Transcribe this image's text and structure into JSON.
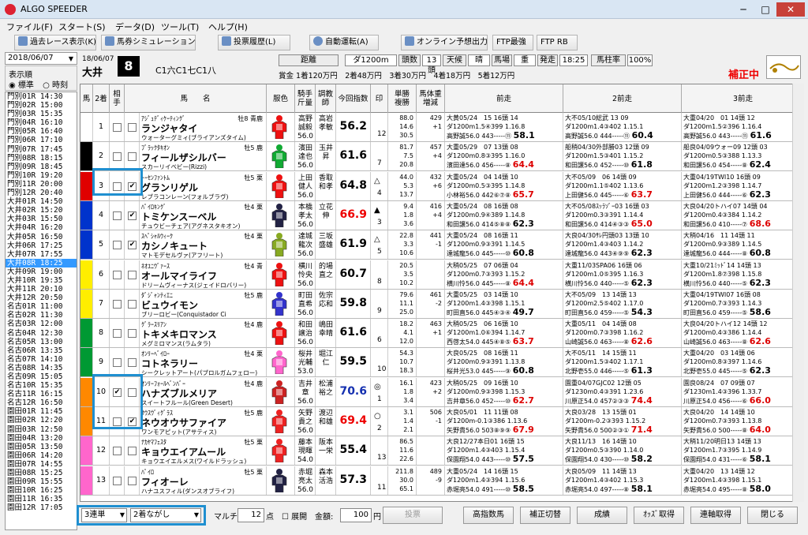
{
  "window": {
    "title": "ALGO SPEEDER",
    "minimize": "─",
    "maximize": "□",
    "close": "✕"
  },
  "menu": [
    "ファイル(F)",
    "スタート(S)",
    "データ(D)",
    "ツール(T)",
    "ヘルプ(H)"
  ],
  "toolbar": [
    "過去レース表示(K)",
    "馬券シミュレーション(B)",
    "投票履歴(L)",
    "自動運転(A)",
    "オンライン予想出力",
    "FTP最強",
    "FTP RB"
  ],
  "left": {
    "date": "2018/06/07",
    "order_label": "表示順",
    "order_opts": [
      "標準",
      "時刻"
    ],
    "races": [
      "門別01R 14:30",
      "門別02R 15:00",
      "門別03R 15:35",
      "門別04R 16:10",
      "門別05R 16:40",
      "門別06R 17:10",
      "門別07R 17:45",
      "門別08R 18:15",
      "門別09R 18:45",
      "門別10R 19:20",
      "門別11R 20:00",
      "門別12R 20:40",
      "大井01R 14:50",
      "大井02R 15:20",
      "大井03R 15:50",
      "大井04R 16:20",
      "大井05R 16:50",
      "大井06R 17:25",
      "大井07R 17:55",
      "大井08R 18:25",
      "大井09R 19:00",
      "大井10R 19:35",
      "大井11R 20:10",
      "大井12R 20:50",
      "名古01R 11:00",
      "名古02R 11:30",
      "名古03R 12:00",
      "名古04R 12:30",
      "名古05R 13:00",
      "名古06R 13:35",
      "名古07R 14:10",
      "名古08R 14:35",
      "名古09R 15:05",
      "名古10R 15:35",
      "名古11R 16:15",
      "名古12R 16:50",
      "園田01R 11:45",
      "園田02R 12:20",
      "園田03R 12:50",
      "園田04R 13:20",
      "園田05R 13:50",
      "園田06R 14:20",
      "園田07R 14:55",
      "園田08R 15:25",
      "園田09R 15:55",
      "園田10R 16:25",
      "園田11R 16:35",
      "園田12R 17:05"
    ],
    "selected": 19
  },
  "header": {
    "date": "18/06/07",
    "venue": "大井",
    "racenum": "8",
    "class": "C1六C1七C1八",
    "cond": [
      [
        "距離",
        "ダ1200m"
      ],
      [
        "頭数",
        "13頭"
      ],
      [
        "天候",
        "晴"
      ],
      [
        "馬場",
        "重"
      ],
      [
        "発走",
        "18:25"
      ],
      [
        "馬柱率",
        "100%"
      ]
    ],
    "prize": "賞金 1着120万円　2着48万円　3着30万円　4着18万円　5着12万円",
    "hoseichu": "補正中"
  },
  "cols": [
    "馬",
    "2着",
    "相手",
    "馬　　名",
    "服色",
    "騎手\n斤量",
    "調教\n師",
    "今回指数",
    "印",
    "単勝\n複勝",
    "馬体重\n増減",
    "前走",
    "2前走",
    "3前走"
  ],
  "horses": [
    {
      "w": 1,
      "n": "1",
      "c2": false,
      "ai": false,
      "sire": "ｱｼﾞｭﾃﾞｨｹｰﾃｨﾝｸﾞ",
      "sex": "牡8 青鹿",
      "name": "ランジャタイ",
      "dam": "ウォーターグミィ(ブライアンズタイム)",
      "jk": "高野\n誠毅\n56.0",
      "tr": "高岩\n孝敏",
      "ix": "56.2",
      "ixc": "",
      "mk": "",
      "pop": "12",
      "od": "88.0\n14.6\n30.5",
      "wt": "429\n+1",
      "p1": [
        "大黄05/24　15 16頭 14",
        "ダ1200m1.5④399 1.16.8",
        "高野誠56.0 443-----⑪ 58.1"
      ],
      "p2": [
        "大不05/10総武 13 09",
        "ダ1200m1.4③402 1.15.1",
        "高野誠56.0 444-----⑪ 60.4"
      ],
      "p3": [
        "大重04/20　01 14頭 12",
        "ダ1200m1.5②396 1.16.4",
        "高野誠56.0 443-----⑪ 61.6"
      ]
    },
    {
      "w": 2,
      "n": "2",
      "c2": false,
      "ai": false,
      "sire": "ﾌﾞﾗｯｸﾀｷｵﾝ",
      "sex": "牡5 鹿",
      "name": "フィールザシルバー",
      "dam": "スカーリイベビー(Rizzi)",
      "jk": "濱田\n達也\n56.0",
      "tr": "玉井\n昇",
      "ix": "61.6",
      "ixc": "",
      "mk": "",
      "pop": "7",
      "od": "81.7\n7.5\n20.8",
      "wt": "457\n+4",
      "p1": [
        "大重05/29　07 13頭 08",
        "ダ1200m0.8③395 1.16.0",
        "濱田達56.0 456-----⑧ 64.4"
      ],
      "p2": [
        "船稍04/30外部勝03 12頭 09",
        "ダ1200m1.5③401 1.15.2",
        "和田譲56.0 452-----⑩ 61.8"
      ],
      "p3": [
        "船良04/09ウォー09 12頭 03",
        "ダ1200m0.5③388 1.13.3",
        "和田譲56.0 454-----⑧ 62.4"
      ]
    },
    {
      "w": 3,
      "n": "3",
      "c2": false,
      "ai": true,
      "sire": "ﾄｰｾﾝﾌｧﾝﾄﾑ",
      "sex": "牡5 栗",
      "name": "グランリゲル",
      "dam": "レブラコンレーン(フォルブラヴ)",
      "jk": "上田\n健人\n56.0",
      "tr": "香取\n和孝",
      "ix": "64.8",
      "ixc": "",
      "mk": "△",
      "pop": "4",
      "od": "44.0\n5.3\n13.7",
      "wt": "432\n+6",
      "p1": [
        "大重05/24　04 14頭 10",
        "ダ1200m0.5③395 1.14.8",
        "小林裕56.0 442⑥⑦⑧ 65.7"
      ],
      "p2": [
        "大不05/09　06 14頭 09",
        "ダ1200m1.1⑤402 1.13.6",
        "上田健56.0 445-----⑥ 63.7"
      ],
      "p3": [
        "大重04/19TWI10 16頭 09",
        "ダ1200m1.2③398 1.14.7",
        "上田健56.0 444-----⑥ 62.3"
      ]
    },
    {
      "w": 4,
      "n": "4",
      "c2": false,
      "ai": true,
      "sire": "ﾊﾟｲﾛｷﾝｸﾞ",
      "sex": "牡4 栗",
      "name": "トミケンスーベル",
      "dam": "チュウビーチェア(アグネスタキオン)",
      "jk": "本橋\n孝太\n56.0",
      "tr": "立花\n伸",
      "ix": "66.9",
      "ixc": "red",
      "mk": "▲",
      "pop": "3",
      "od": "9.4\n1.8\n3.6",
      "wt": "416\n+4",
      "p1": [
        "大重05/24　08 16頭 08",
        "ダ1200m0.9④389 1.14.8",
        "和田譲56.0 414⑤⑧⑧ 62.3"
      ],
      "p2": [
        "大不05/08ｽｯﾗｿﾞｰ03 16頭 03",
        "ダ1200m0.3③391 1.14.4",
        "和田譲56.0 414④③③ 65.0"
      ],
      "p3": [
        "大良04/20トハイ07 14頭 04",
        "ダ1200m0.4③384 1.14.2",
        "和田譲56.0 410-----⑦ 68.6"
      ]
    },
    {
      "w": 4,
      "n": "5",
      "c2": false,
      "ai": true,
      "sire": "ｽﾍﾟｼｬﾙｳｨｰｸ",
      "sex": "牡4 栗",
      "name": "カシノキュート",
      "dam": "マトモデセルヴァ(アフリート)",
      "jk": "達城\n龍次\n56.0",
      "tr": "三坂\n盛雄",
      "ix": "61.9",
      "ixc": "",
      "mk": "△",
      "pop": "5",
      "od": "22.8\n3.3\n10.6",
      "wt": "441\n-1",
      "p1": [
        "大重05/24　08 16頭 11",
        "ダ1200m0.9③391 1.14.5",
        "達城龍56.0 445-----⑩ 60.8"
      ],
      "p2": [
        "大良04/30ｻﾚ円頭03 13頭 10",
        "ダ1200m1.4③403 1.14.2",
        "達城龍56.0 443④⑨⑨ 62.3"
      ],
      "p3": [
        "大稍04/16　11 14頭 11",
        "ダ1200m0.9③389 1.14.5",
        "達城龍56.0 444-----⑧ 60.8"
      ]
    },
    {
      "w": 5,
      "n": "6",
      "c2": false,
      "ai": false,
      "sire": "ﾈｵﾕﾆｳﾞｧｰｽ",
      "sex": "牡4 青",
      "name": "オールマイライフ",
      "dam": "ドリームヴィーナス(ジェイドロバリー)",
      "jk": "横川\n怜央\n56.0",
      "tr": "的場\n直之",
      "ix": "60.7",
      "ixc": "",
      "mk": "",
      "pop": "8",
      "od": "20.5\n3.5\n10.2",
      "wt": "",
      "p1": [
        "大稍05/25　07 06頭 04",
        "ダ1200m0.7③393 1.15.2",
        "横川怜56.0 445-----⑧ 64.4"
      ],
      "p2": [
        "大重11/03SPA06 16頭 06",
        "ダ1200m1.0⑤395 1.16.3",
        "横川怜56.0 440-----⑤ 62.3"
      ],
      "p3": [
        "大重10/21ﾐｯﾄﾞ14 14頭 13",
        "ダ1200m1.8⑦398 1.15.8",
        "横川怜56.0 440-----⑤ 62.3"
      ]
    },
    {
      "w": 5,
      "n": "7",
      "c2": false,
      "ai": false,
      "sire": "ﾀﾞｼﾞｬﾝﾃｨｴﾆ",
      "sex": "牡5 鹿",
      "name": "ビュウイモン",
      "dam": "ブリーロビー(Conquistador Ci",
      "jk": "町田\n直希\n56.0",
      "tr": "佐宗\n応和",
      "ix": "59.8",
      "ixc": "",
      "mk": "",
      "pop": "9",
      "od": "79.6\n11.1\n25.0",
      "wt": "461\n-2",
      "p1": [
        "大重05/25　03 14頭 10",
        "ダ1200m1.4③398 1.15.1",
        "町田直56.0 445④③④ 49.7"
      ],
      "p2": [
        "大不05/09　13 14頭 13",
        "ダ1200m2.5⑤402 1.17.0",
        "町田直56.0 459-----⑤ 54.3"
      ],
      "p3": [
        "大重04/19TWI07 16頭 08",
        "ダ1200m0.7③393 1.14.3",
        "町田直56.0 459-----⑤ 58.6"
      ]
    },
    {
      "w": 6,
      "n": "8",
      "c2": false,
      "ai": false,
      "sire": "ｸﾞﾗｰｽﾘｱﾝ",
      "sex": "牡4 鹿",
      "name": "トキメキロマンス",
      "dam": "メグミロマンス(ラムタラ)",
      "jk": "和田\n譲治\n56.0",
      "tr": "嶋田\n幸晴",
      "ix": "61.6",
      "ixc": "",
      "mk": "",
      "pop": "6",
      "od": "18.2\n4.1\n12.0",
      "wt": "463\n+1",
      "p1": [
        "大稍05/25　06 16頭 10",
        "ダ1200m1.0⑥394 1.14.7",
        "西啓太54.0 445④⑧⑤ 63.7"
      ],
      "p2": [
        "大重05/11　04 14頭 08",
        "ダ1200m0.7③398 1.16.2",
        "山崎誠56.0 463-----⑧ 62.6"
      ],
      "p3": [
        "大良04/20トハイ12 14頭 12",
        "ダ1200m0.4③386 1.14.4",
        "山崎誠56.0 463-----⑧ 62.6"
      ]
    },
    {
      "w": 6,
      "n": "9",
      "c2": false,
      "ai": false,
      "sire": "ｵﾝﾘｰﾍﾞｲﾛｰ",
      "sex": "牡4 栗",
      "name": "コトネラリー",
      "dam": "シークレットアート(パブロルガムフェロー)",
      "jk": "桜井\n光輔\n53.0",
      "tr": "堀江\n仁",
      "ix": "59.5",
      "ixc": "",
      "mk": "",
      "pop": "10",
      "od": "54.3\n10.7\n18.3",
      "wt": "",
      "p1": [
        "大良05/25　08 16頭 11",
        "ダ1200m0.9③391 1.13.8",
        "桜井光53.0 445-----⑨ 60.8"
      ],
      "p2": [
        "大不05/11　14 15頭 11",
        "ダ1200m1.5③402 1.17.1",
        "北野壱55.0 446-----⑤ 61.3"
      ],
      "p3": [
        "大重04/20　03 14頭 06",
        "ダ1200m0.8③397 1.14.6",
        "北野壱55.0 445-----⑤ 62.3"
      ]
    },
    {
      "w": 7,
      "n": "10",
      "c2": true,
      "ai": false,
      "sire": "ｵﾝﾘｰﾌｫｰﾙﾍﾞﾝﾊﾞｰ",
      "sex": "牡4 鹿",
      "name": "ハナズブルメリア",
      "dam": "スイートフルール(Green Desert)",
      "jk": "吉井\n章\n56.0",
      "tr": "松浦\n裕之",
      "ix": "70.6",
      "ixc": "blue",
      "mk": "◎",
      "pop": "1",
      "od": "16.1\n1.8\n3.4",
      "wt": "423\n+2",
      "p1": [
        "大稍05/25　09 16頭 10",
        "ダ1200m0.9③398 1.15.3",
        "吉井章56.0 452-----⑩ 62.7"
      ],
      "p2": [
        "園重04/07GJC02 12頭 05",
        "ダ1230m0.4③391 1.23.6",
        "川原正54.0 457②③③ 74.4"
      ],
      "p3": [
        "園良08/24　07 09頭 07",
        "ダ1230m1.4③396 1.33.7",
        "川原正54.0 456-----⑥ 66.0"
      ]
    },
    {
      "w": 7,
      "n": "11",
      "c2": false,
      "ai": true,
      "sire": "ｻｳｽｳﾞｨｸﾞﾗｽ",
      "sex": "牡5 鹿",
      "name": "ネウオウサファイア",
      "dam": "ワンモアピット(アサティス)",
      "jk": "矢野\n貴之\n56.0",
      "tr": "渡辺\n和雄",
      "ix": "69.4",
      "ixc": "red",
      "mk": "○",
      "pop": "2",
      "od": "3.1\n1.4\n2.1",
      "wt": "506\n-1",
      "p1": [
        "大良05/01　11 11頭 08",
        "ダ1200m-0.1③386 1.13.6",
        "矢野貴56.0 503⑧⑨⑨ 67.9"
      ],
      "p2": [
        "大良03/28　13 15頭 01",
        "ダ1200m-0.2③393 1.15.2",
        "矢野貴56.0 500②③① 71.4"
      ],
      "p3": [
        "大良04/20　14 14頭 10",
        "ダ1200m0.7③393 1.13.8",
        "矢野貴56.0 500-----⑧ 64.0"
      ]
    },
    {
      "w": 8,
      "n": "12",
      "c2": false,
      "ai": false,
      "sire": "ﾅｶﾔﾏﾌｪｽﾀ",
      "sex": "牡5 栗",
      "name": "キョウエイアムール",
      "dam": "キョウエイエルメス(ワイルドラッシュ)",
      "jk": "藤本\n現暉\n54.0",
      "tr": "阪本\n一栄",
      "ix": "55.4",
      "ixc": "",
      "mk": "",
      "pop": "13",
      "od": "86.5\n11.6\n22.6",
      "wt": "",
      "p1": [
        "大良12/27本日01 16頭 15",
        "ダ1200m1.4③403 1.15.4",
        "保園翔54.0 443-----⑩ 57.5"
      ],
      "p2": [
        "大良11/13　16 14頭 10",
        "ダ1200m0.5③390 1.14.0",
        "保園翔54.0 430-----⑩ 58.2"
      ],
      "p3": [
        "大稍11/20明日13 14頭 13",
        "ダ1200m1.7③395 1.14.9",
        "保園翔54.0 431-----⑥ 58.1"
      ]
    },
    {
      "w": 8,
      "n": "13",
      "c2": false,
      "ai": false,
      "sire": "ﾊﾟｲﾛ",
      "sex": "牡5 栗",
      "name": "フィオーレ",
      "dam": "ハナユスフィル(ダンスオブライフ)",
      "jk": "赤堀\n亮太\n56.0",
      "tr": "森本\n活浩",
      "ix": "57.3",
      "ixc": "",
      "mk": "",
      "pop": "11",
      "od": "211.8\n30.0\n65.1",
      "wt": "489\n-9",
      "p1": [
        "大重05/24　14 16頭 15",
        "ダ1200m1.4③394 1.15.6",
        "赤堀亮54.0 491-----⑩ 58.5"
      ],
      "p2": [
        "大良05/09　11 14頭 13",
        "ダ1200m1.4③402 1.15.3",
        "赤堀亮54.0 497-----⑧ 58.1"
      ],
      "p3": [
        "大重04/20　13 14頭 12",
        "ダ1200m1.4③398 1.15.1",
        "赤堀亮54.0 495-----⑧ 58.0"
      ]
    }
  ],
  "bottom": {
    "bettype": "3連単",
    "mode": "2着ながし",
    "multi": "マルチ",
    "pts": "12",
    "pts_u": "点",
    "tenkai": "展開",
    "kingaku": "金額:",
    "amount": "100",
    "yen": "円",
    "vote": "投票",
    "buttons": [
      "高指数馬",
      "補正切替",
      "成績",
      "ｵｯｽﾞ取得",
      "連軸取得",
      "閉じる"
    ]
  },
  "wakucolors": {
    "1": "#ffffff",
    "2": "#000000",
    "3": "#e00000",
    "4": "#0033cc",
    "5": "#ffee00",
    "6": "#009933",
    "7": "#ff8800",
    "8": "#ff66cc"
  },
  "silks": [
    "#e11",
    "#1a3",
    "#e11",
    "#224",
    "#8a2",
    "#e11",
    "#33c",
    "#e11",
    "#f6c",
    "#c22",
    "#e22",
    "#e22",
    "#224"
  ]
}
